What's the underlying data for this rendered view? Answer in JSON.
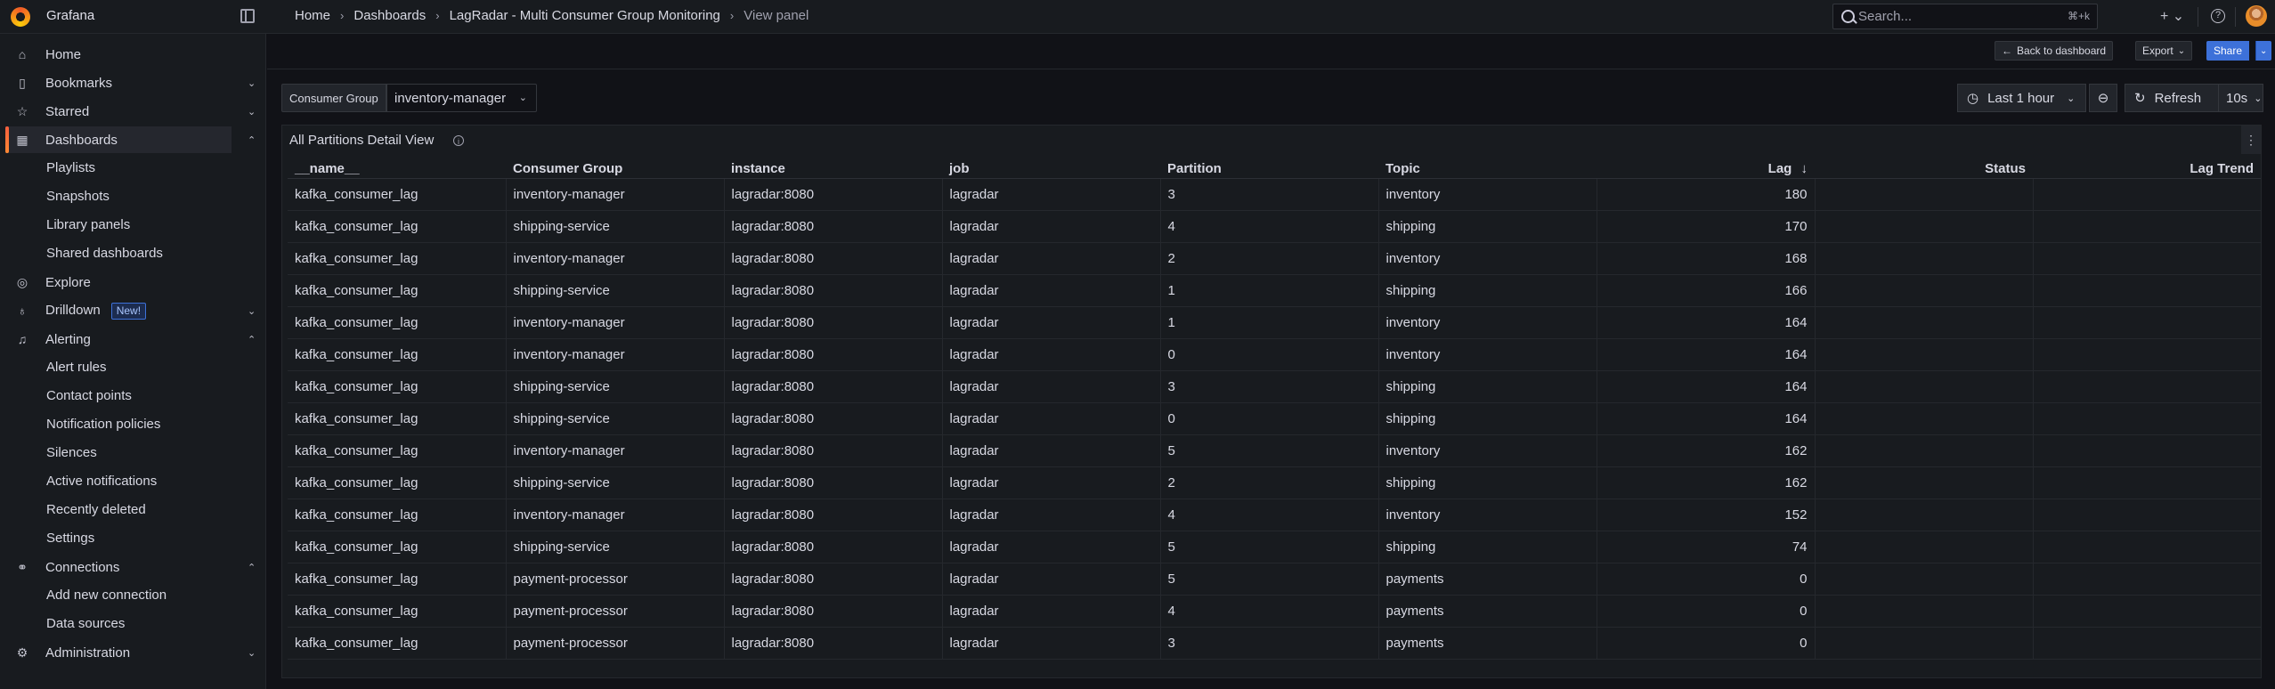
{
  "app": {
    "name": "Grafana"
  },
  "breadcrumb": [
    "Home",
    "Dashboards",
    "LagRadar - Multi Consumer Group Monitoring",
    "View panel"
  ],
  "search": {
    "placeholder": "Search...",
    "shortcut": "⌘+k"
  },
  "topbar_icons": [
    "plus-icon",
    "help-icon",
    "avatar"
  ],
  "sidebar": {
    "items": [
      {
        "label": "Home",
        "icon": "home-icon"
      },
      {
        "label": "Bookmarks",
        "icon": "bookmark-icon"
      },
      {
        "label": "Starred",
        "icon": "star-icon"
      },
      {
        "label": "Dashboards",
        "icon": "apps-icon"
      },
      {
        "label": "Explore",
        "icon": "compass-icon"
      },
      {
        "label": "Drilldown",
        "icon": "microphone-icon",
        "badge": "New!"
      },
      {
        "label": "Alerting",
        "icon": "bell-icon"
      },
      {
        "label": "Connections",
        "icon": "connections-icon"
      },
      {
        "label": "Administration",
        "icon": "gear-icon"
      }
    ],
    "dashboards_children": [
      "Playlists",
      "Snapshots",
      "Library panels",
      "Shared dashboards"
    ],
    "alerting_children": [
      "Alert rules",
      "Contact points",
      "Notification policies",
      "Silences",
      "Active notifications",
      "Recently deleted",
      "Settings"
    ],
    "connections_children": [
      "Add new connection",
      "Data sources"
    ]
  },
  "toolbar": {
    "back": "Back to dashboard",
    "export": "Export",
    "share": "Share"
  },
  "variables": {
    "label": "Consumer Group",
    "value": "inventory-manager"
  },
  "time": {
    "range": "Last 1 hour",
    "refresh": "Refresh",
    "interval": "10s"
  },
  "panel": {
    "title": "All Partitions Detail View",
    "columns": [
      "__name__",
      "Consumer Group",
      "instance",
      "job",
      "Partition",
      "Topic",
      "Lag",
      "Status",
      "Lag Trend"
    ],
    "sort_indicator": "↓",
    "rows": [
      [
        "kafka_consumer_lag",
        "inventory-manager",
        "lagradar:8080",
        "lagradar",
        "3",
        "inventory",
        "180",
        "",
        ""
      ],
      [
        "kafka_consumer_lag",
        "shipping-service",
        "lagradar:8080",
        "lagradar",
        "4",
        "shipping",
        "170",
        "",
        ""
      ],
      [
        "kafka_consumer_lag",
        "inventory-manager",
        "lagradar:8080",
        "lagradar",
        "2",
        "inventory",
        "168",
        "",
        ""
      ],
      [
        "kafka_consumer_lag",
        "shipping-service",
        "lagradar:8080",
        "lagradar",
        "1",
        "shipping",
        "166",
        "",
        ""
      ],
      [
        "kafka_consumer_lag",
        "inventory-manager",
        "lagradar:8080",
        "lagradar",
        "1",
        "inventory",
        "164",
        "",
        ""
      ],
      [
        "kafka_consumer_lag",
        "inventory-manager",
        "lagradar:8080",
        "lagradar",
        "0",
        "inventory",
        "164",
        "",
        ""
      ],
      [
        "kafka_consumer_lag",
        "shipping-service",
        "lagradar:8080",
        "lagradar",
        "3",
        "shipping",
        "164",
        "",
        ""
      ],
      [
        "kafka_consumer_lag",
        "shipping-service",
        "lagradar:8080",
        "lagradar",
        "0",
        "shipping",
        "164",
        "",
        ""
      ],
      [
        "kafka_consumer_lag",
        "inventory-manager",
        "lagradar:8080",
        "lagradar",
        "5",
        "inventory",
        "162",
        "",
        ""
      ],
      [
        "kafka_consumer_lag",
        "shipping-service",
        "lagradar:8080",
        "lagradar",
        "2",
        "shipping",
        "162",
        "",
        ""
      ],
      [
        "kafka_consumer_lag",
        "inventory-manager",
        "lagradar:8080",
        "lagradar",
        "4",
        "inventory",
        "152",
        "",
        ""
      ],
      [
        "kafka_consumer_lag",
        "shipping-service",
        "lagradar:8080",
        "lagradar",
        "5",
        "shipping",
        "74",
        "",
        ""
      ],
      [
        "kafka_consumer_lag",
        "payment-processor",
        "lagradar:8080",
        "lagradar",
        "5",
        "payments",
        "0",
        "",
        ""
      ],
      [
        "kafka_consumer_lag",
        "payment-processor",
        "lagradar:8080",
        "lagradar",
        "4",
        "payments",
        "0",
        "",
        ""
      ],
      [
        "kafka_consumer_lag",
        "payment-processor",
        "lagradar:8080",
        "lagradar",
        "3",
        "payments",
        "0",
        "",
        ""
      ]
    ]
  },
  "colors": {
    "accent": "#3d71d9",
    "active_bar": "#f55f3e",
    "background": "#111217",
    "surface": "#181b1f"
  }
}
